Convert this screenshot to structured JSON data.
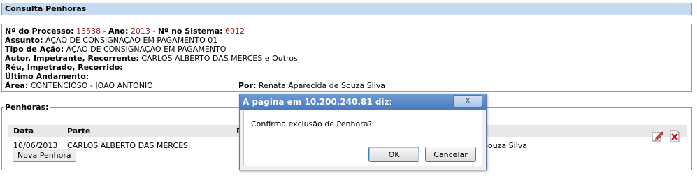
{
  "header": {
    "title": "Consulta Penhoras"
  },
  "info": {
    "processo_label": "Nº do Processo:",
    "processo_value": "13538",
    "ano_sep": " - ",
    "ano_label": "Ano:",
    "ano_value": "2013",
    "sistema_sep": " - ",
    "sistema_label": "Nº no Sistema:",
    "sistema_value": "6012",
    "assunto_label": "Assunto:",
    "assunto_value": "AÇÃO DE CONSIGNAÇÃO EM PAGAMENTO 01",
    "tipo_label": "Tipo de Ação:",
    "tipo_value": "AÇÃO DE CONSIGNAÇÃO EM PAGAMENTO",
    "autor_label": "Autor, Impetrante, Recorrente:",
    "autor_value": "CARLOS ALBERTO DAS MERCES e Outros",
    "reu_label": "Réu, Impetrado, Recorrido:",
    "ultimo_label": "Último Andamento:",
    "area_label": "Área:",
    "area_value": "CONTENCIOSO - JOAO ANTONIO",
    "por_label": "Por:",
    "por_value": "Renata Aparecida de Souza Silva"
  },
  "penhoras": {
    "legend": "Penhoras:",
    "columns": [
      "Data",
      "Parte",
      "P"
    ],
    "rows": [
      {
        "data": "10/06/2013",
        "parte": "CARLOS ALBERTO DAS MERCES",
        "por_partial": "Souza Silva"
      }
    ],
    "nova_button": "Nova Penhora",
    "edit_icon": "edit-pencil-icon",
    "delete_icon": "delete-x-icon"
  },
  "dialog": {
    "title": "A página em 10.200.240.81 diz:",
    "close_label": "X",
    "message": "Confirma exclusão de Penhora?",
    "ok_label": "OK",
    "cancel_label": "Cancelar"
  }
}
